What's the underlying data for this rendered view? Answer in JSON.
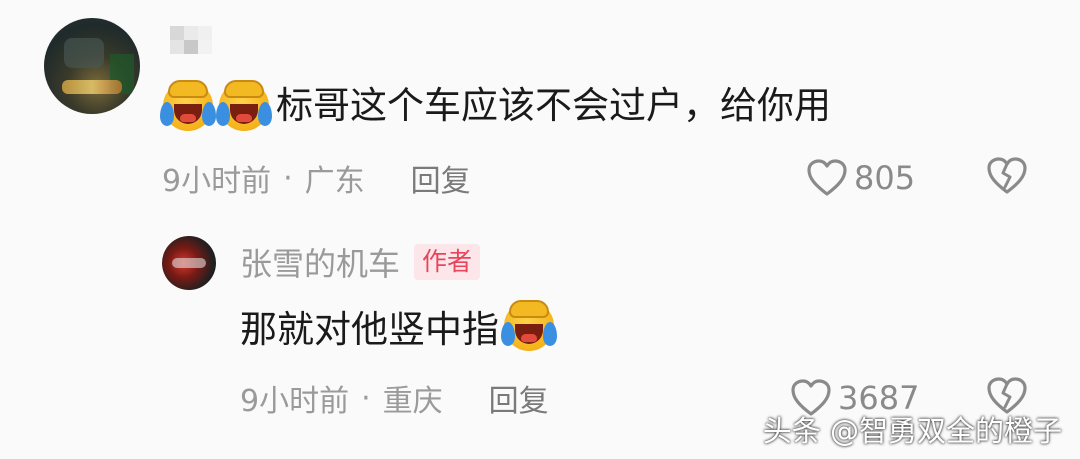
{
  "comment": {
    "text": "标哥这个车应该不会过户，给你用",
    "time": "9小时前",
    "location": "广东",
    "reply_label": "回复",
    "likes": "805",
    "emojis": [
      "laugh-cry-emoji",
      "laugh-cry-emoji"
    ]
  },
  "reply": {
    "author": "张雪的机车",
    "badge": "作者",
    "text": "那就对他竖中指",
    "time": "9小时前",
    "location": "重庆",
    "reply_label": "回复",
    "likes": "3687",
    "emojis": [
      "laugh-cry-emoji"
    ]
  },
  "watermark": "头条 @智勇双全的橙子",
  "icons": [
    "heart-outline-icon",
    "broken-heart-icon"
  ],
  "colors": {
    "background": "#fafafa",
    "text": "#1a1a1a",
    "meta": "#9a9a9a",
    "badge_text": "#e8455c",
    "badge_bg": "#fde6ea"
  }
}
